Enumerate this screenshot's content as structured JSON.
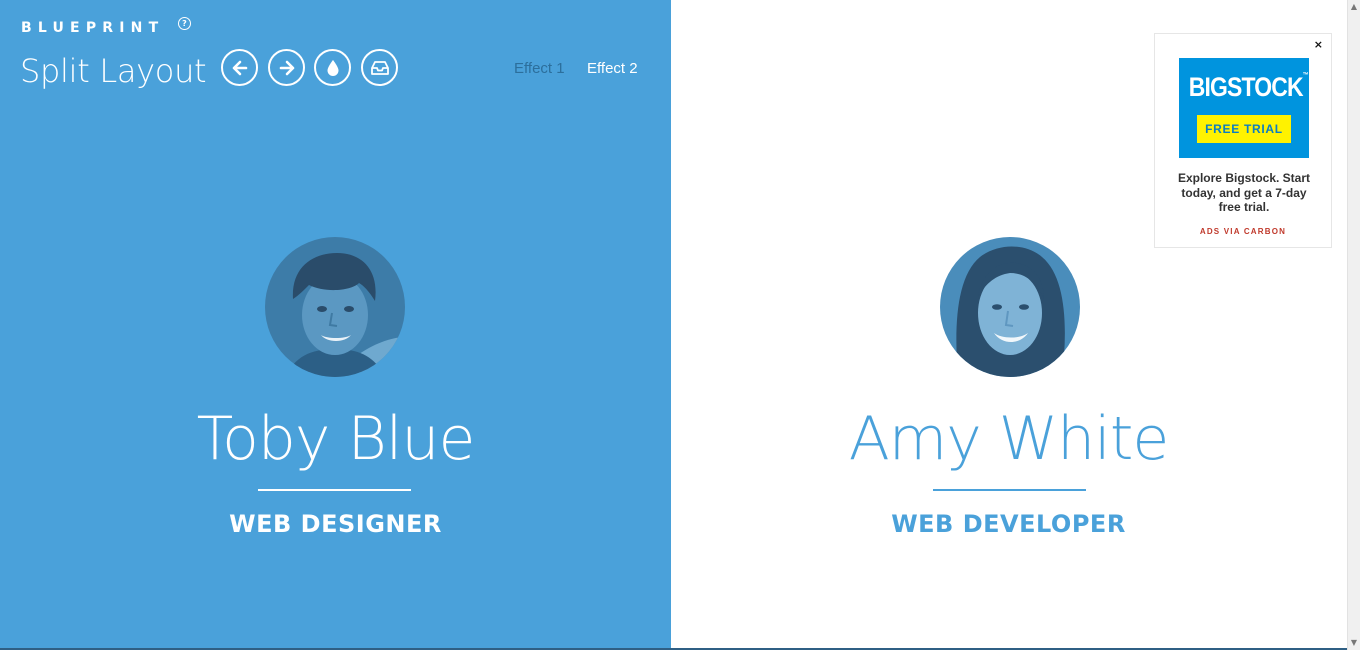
{
  "header": {
    "brand": "BLUEPRINT",
    "help_icon": "?",
    "title": "Split Layout",
    "nav_icons": [
      "arrow-left-icon",
      "arrow-right-icon",
      "droplet-icon",
      "inbox-icon"
    ],
    "effects": [
      {
        "label": "Effect 1",
        "active": true
      },
      {
        "label": "Effect 2",
        "active": false
      }
    ]
  },
  "profiles": [
    {
      "name": "Toby Blue",
      "role": "WEB DESIGNER",
      "avatar_icon": "avatar-photo-male"
    },
    {
      "name": "Amy White",
      "role": "WEB DEVELOPER",
      "avatar_icon": "avatar-photo-female"
    }
  ],
  "ad": {
    "close": "×",
    "brand": "BIGSTOCK",
    "trademark": "™",
    "cta": "FREE TRIAL",
    "text": "Explore Bigstock. Start today, and get a 7-day free trial.",
    "via": "ADS VIA CARBON"
  },
  "colors": {
    "left_bg": "#4aa1da",
    "right_bg": "#ffffff",
    "accent": "#4aa1da",
    "active_link": "#2c6f9c",
    "ad_blue": "#0094de",
    "ad_yellow": "#fff200",
    "ad_red": "#c0392b"
  }
}
